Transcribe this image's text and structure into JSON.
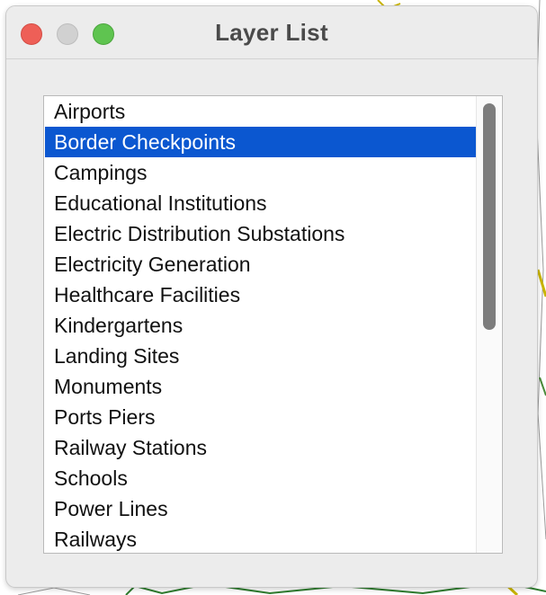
{
  "window": {
    "title": "Layer List"
  },
  "layers": {
    "selected_index": 1,
    "items": [
      {
        "label": "Airports"
      },
      {
        "label": "Border Checkpoints"
      },
      {
        "label": "Campings"
      },
      {
        "label": "Educational Institutions"
      },
      {
        "label": "Electric Distribution Substations"
      },
      {
        "label": "Electricity Generation"
      },
      {
        "label": "Healthcare Facilities"
      },
      {
        "label": "Kindergartens"
      },
      {
        "label": "Landing Sites"
      },
      {
        "label": "Monuments"
      },
      {
        "label": "Ports Piers"
      },
      {
        "label": "Railway Stations"
      },
      {
        "label": "Schools"
      },
      {
        "label": "Power Lines"
      },
      {
        "label": "Railways"
      }
    ]
  },
  "colors": {
    "selection": "#0b57d0",
    "close": "#ee5f57",
    "minimize": "#d1d1d1",
    "zoom": "#5fc450"
  }
}
